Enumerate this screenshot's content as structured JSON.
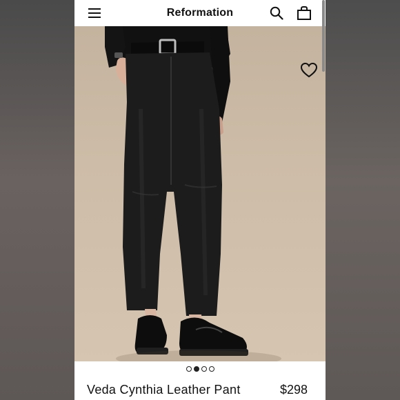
{
  "header": {
    "brand": "Reformation",
    "icons": [
      "menu-icon",
      "search-icon",
      "bag-icon"
    ]
  },
  "gallery": {
    "image": "black leather straight-leg pants with belt and loafers",
    "favorite_icon": "heart-icon",
    "pages": 4,
    "active_page": 2
  },
  "product": {
    "name": "Veda Cynthia Leather Pant",
    "price": "$298"
  },
  "colors": {
    "background": "#ffffff",
    "text": "#111111",
    "photo_backdrop": "#cdbca7"
  }
}
